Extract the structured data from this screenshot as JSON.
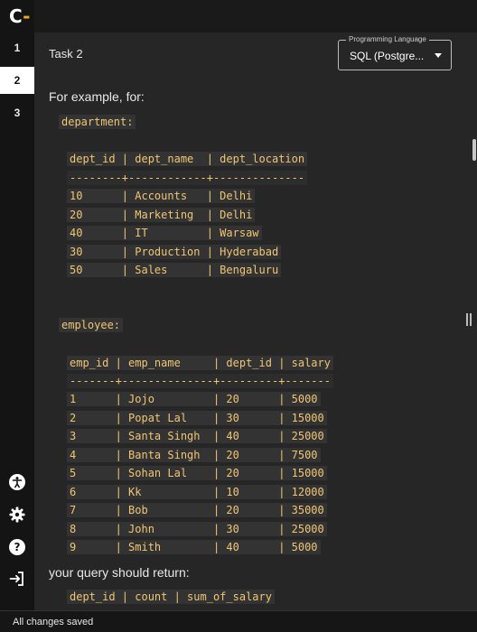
{
  "app": {
    "logo_letter": "C",
    "logo_dash": "-"
  },
  "questions": [
    "1",
    "2",
    "3"
  ],
  "active_question": "2",
  "sidebar_icons": [
    "accessibility-icon",
    "settings-icon",
    "help-icon",
    "logout-icon"
  ],
  "task": {
    "title": "Task 2"
  },
  "language": {
    "legend": "Programming Language",
    "value": "SQL (Postgre..."
  },
  "content": {
    "intro": "For example, for:",
    "dept_label": "department:",
    "dept_header": "dept_id | dept_name  | dept_location",
    "dept_sep": "--------+------------+--------------",
    "dept_rows": [
      "10      | Accounts   | Delhi",
      "20      | Marketing  | Delhi",
      "40      | IT         | Warsaw",
      "30      | Production | Hyderabad",
      "50      | Sales      | Bengaluru"
    ],
    "emp_label": "employee:",
    "emp_header": "emp_id | emp_name     | dept_id | salary",
    "emp_sep": "-------+--------------+---------+-------",
    "emp_rows": [
      "1      | Jojo         | 20      | 5000",
      "2      | Popat Lal    | 30      | 15000",
      "3      | Santa Singh  | 40      | 25000",
      "4      | Banta Singh  | 20      | 7500",
      "5      | Sohan Lal    | 20      | 15000",
      "6      | Kk           | 10      | 12000",
      "7      | Bob          | 20      | 35000",
      "8      | John         | 30      | 25000",
      "9      | Smith        | 40      | 5000"
    ],
    "result_intro": "your query should return:",
    "result_header_partial": "dept_id | count | sum_of_salary"
  },
  "status": {
    "text": "All changes saved"
  },
  "colors": {
    "code_text": "#f0c674",
    "code_bg": "#333333",
    "active_tab_bg": "#ffffff",
    "logo_dash": "#f5a623"
  }
}
